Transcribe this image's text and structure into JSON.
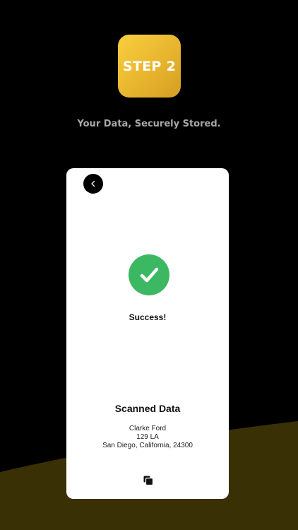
{
  "header": {
    "step_label": "STEP 2",
    "tagline": "Your Data, Securely Stored."
  },
  "card": {
    "back_icon": "chevron-left-icon",
    "status_icon": "check-circle-icon",
    "status_text": "Success!",
    "section_title": "Scanned Data",
    "address_lines": [
      "Clarke Ford",
      "129 LA",
      "San Diego, California, 24300"
    ],
    "copy_icon": "copy-icon"
  },
  "colors": {
    "background": "#000000",
    "accent_gold": "#e8b52e",
    "wave": "#3a3006",
    "success_green": "#3cb862",
    "card": "#ffffff"
  }
}
